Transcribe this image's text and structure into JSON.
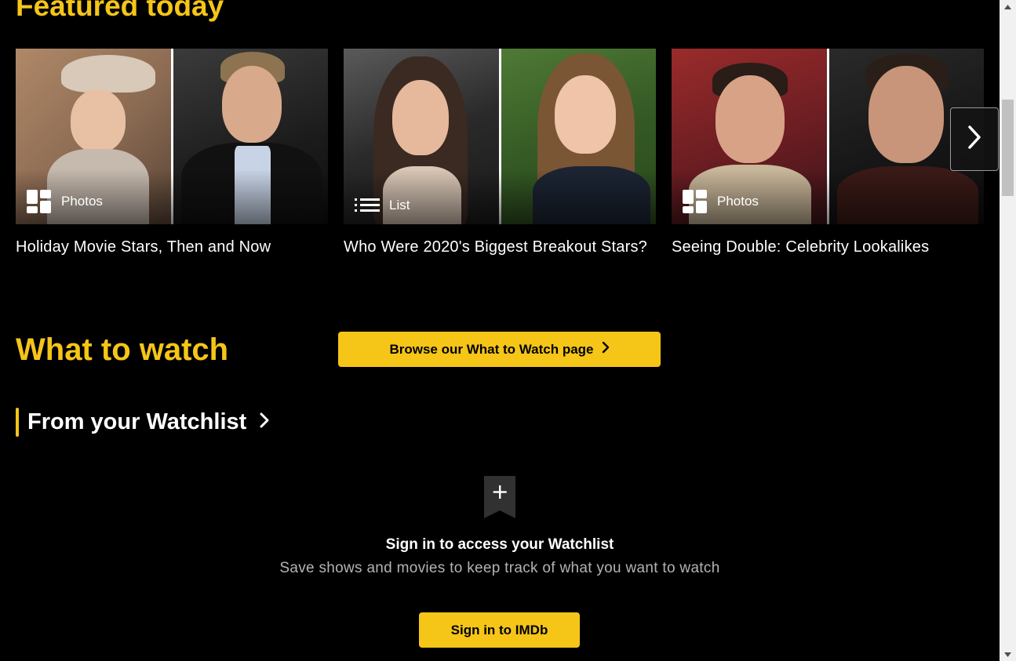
{
  "featured": {
    "title": "Featured today",
    "cards": [
      {
        "badge_icon": "photos-icon",
        "badge_label": "Photos",
        "caption": "Holiday Movie Stars, Then and Now"
      },
      {
        "badge_icon": "list-icon",
        "badge_label": "List",
        "caption": "Who Were 2020's Biggest Breakout Stars?"
      },
      {
        "badge_icon": "photos-icon",
        "badge_label": "Photos",
        "caption": "Seeing Double: Celebrity Lookalikes"
      }
    ],
    "next_icon": "chevron-right-icon"
  },
  "what_to_watch": {
    "title": "What to watch",
    "browse_label": "Browse our What to Watch page"
  },
  "watchlist": {
    "title": "From your Watchlist",
    "ribbon_icon": "watchlist-add-icon",
    "heading": "Sign in to access your Watchlist",
    "subtext": "Save shows and movies to keep track of what you want to watch",
    "signin_label": "Sign in to IMDb"
  },
  "colors": {
    "accent": "#f5c518",
    "background": "#000000",
    "subtext": "#b3b3b3"
  }
}
